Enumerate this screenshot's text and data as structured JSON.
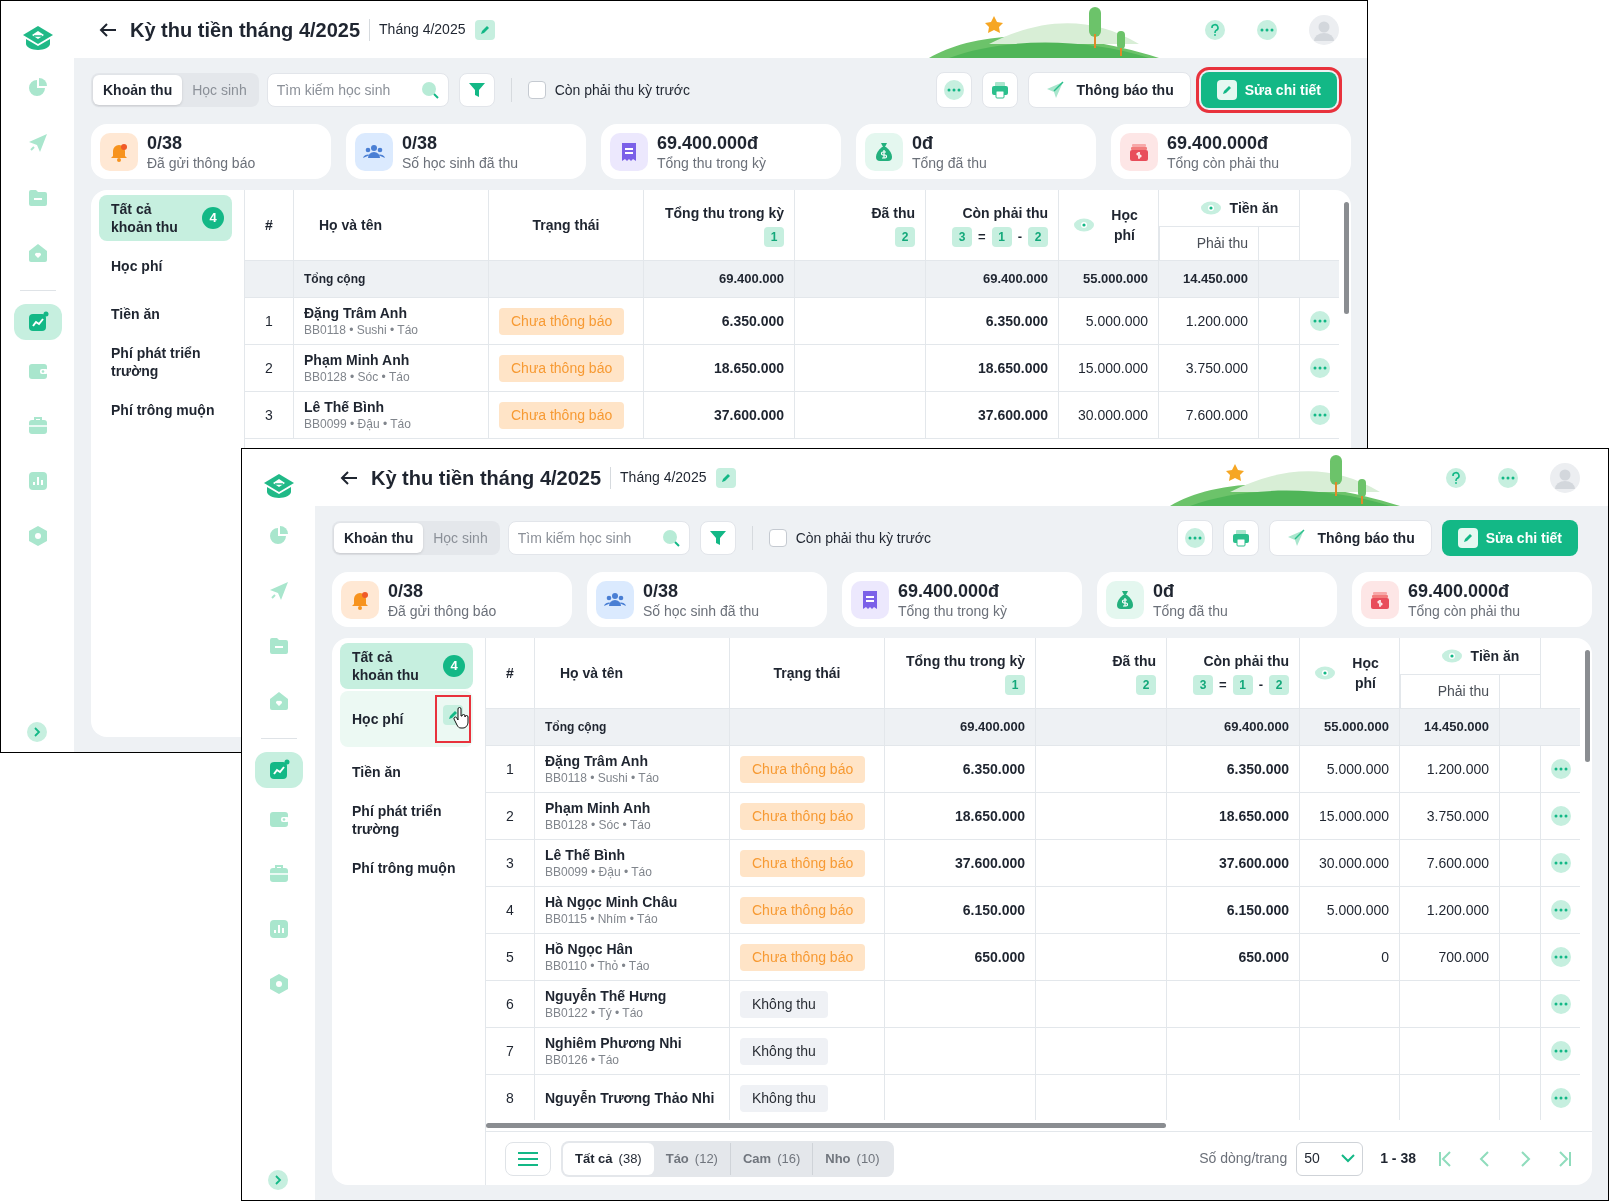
{
  "windows": [
    {
      "sidebar": {
        "items": [
          {
            "kind": "pie",
            "selected": false
          },
          {
            "kind": "send",
            "selected": false
          },
          {
            "kind": "folder",
            "selected": false
          },
          {
            "kind": "home",
            "selected": false
          },
          {
            "kind": "chart",
            "selected": true
          },
          {
            "kind": "wallet",
            "selected": false
          },
          {
            "kind": "briefcase",
            "selected": false
          },
          {
            "kind": "bars",
            "selected": false
          },
          {
            "kind": "hexagon",
            "selected": false
          }
        ]
      },
      "header": {
        "title": "Kỳ thu tiền tháng 4/2025",
        "period": "Tháng 4/2025"
      },
      "toolbar": {
        "tabs": [
          {
            "label": "Khoản thu",
            "selected": true
          },
          {
            "label": "Học sinh",
            "selected": false
          }
        ],
        "search": {
          "placeholder": "Tìm kiếm học sinh"
        },
        "checkbox": {
          "label": "Còn phải thu kỳ trước",
          "checked": false
        },
        "buttons": [
          {
            "kind": "more",
            "highlighted": false
          },
          {
            "kind": "print",
            "highlighted": false
          },
          {
            "kind": "send",
            "label": "Thông báo thu",
            "highlighted": false
          },
          {
            "kind": "edit",
            "label": "Sửa chi tiết",
            "highlighted": true
          }
        ]
      },
      "stats": [
        {
          "kind": "bell",
          "value": "0/38",
          "label": "Đã gửi thông báo"
        },
        {
          "kind": "people",
          "value": "0/38",
          "label": "Số học sinh đã thu"
        },
        {
          "kind": "receipt",
          "value": "69.400.000đ",
          "label": "Tổng thu trong kỳ"
        },
        {
          "kind": "moneybag",
          "value": "0đ",
          "label": "Tổng đã thu"
        },
        {
          "kind": "cash",
          "value": "69.400.000đ",
          "label": "Tổng còn phải thu"
        }
      ],
      "categories": [
        {
          "label": "Tất cả khoản thu",
          "count": "4",
          "selected": true,
          "hovered": false
        },
        {
          "label": "Học phí",
          "selected": false,
          "hovered": false
        },
        {
          "label": "Tiền ăn",
          "selected": false,
          "hovered": false
        },
        {
          "label": "Phí phát triển trường",
          "selected": false,
          "hovered": false
        },
        {
          "label": "Phí trông muộn",
          "selected": false,
          "hovered": false
        }
      ],
      "table": {
        "columns": {
          "index": "#",
          "name": "Họ và tên",
          "status": "Trạng thái",
          "total": {
            "label": "Tổng thu trong kỳ",
            "formula": [
              {
                "kind": "badge",
                "text": "1"
              }
            ]
          },
          "paid": {
            "label": "Đã thu",
            "formula": [
              {
                "kind": "badge",
                "text": "2"
              }
            ]
          },
          "remaining": {
            "label": "Còn phải thu",
            "formula": [
              {
                "kind": "badge",
                "text": "3"
              },
              {
                "kind": "op",
                "text": "="
              },
              {
                "kind": "badge",
                "text": "1"
              },
              {
                "kind": "op",
                "text": "-"
              },
              {
                "kind": "badge",
                "text": "2"
              }
            ]
          },
          "tuition": "Học phí",
          "meals": {
            "label": "Tiền ăn",
            "sub": "Phải thu"
          }
        },
        "total_row": {
          "label": "Tổng cộng",
          "total": "69.400.000",
          "remaining": "69.400.000",
          "tuition": "55.000.000",
          "meals": "14.450.000"
        },
        "rows": [
          {
            "index": "1",
            "name": "Đặng Trâm Anh",
            "meta": "BB0118 • Sushi • Táo",
            "status": "Chưa thông báo",
            "kind": "pending",
            "total": "6.350.000",
            "remaining": "6.350.000",
            "tuition": "5.000.000",
            "meals": "1.200.000"
          },
          {
            "index": "2",
            "name": "Phạm Minh Anh",
            "meta": "BB0128 • Sóc • Táo",
            "status": "Chưa thông báo",
            "kind": "pending",
            "total": "18.650.000",
            "remaining": "18.650.000",
            "tuition": "15.000.000",
            "meals": "3.750.000"
          },
          {
            "index": "3",
            "name": "Lê Thế Bình",
            "meta": "BB0099 • Đậu • Táo",
            "status": "Chưa thông báo",
            "kind": "pending",
            "total": "37.600.000",
            "remaining": "37.600.000",
            "tuition": "30.000.000",
            "meals": "7.600.000"
          }
        ]
      }
    },
    {
      "sidebar": {
        "items": [
          {
            "kind": "pie",
            "selected": false
          },
          {
            "kind": "send",
            "selected": false
          },
          {
            "kind": "folder",
            "selected": false
          },
          {
            "kind": "home",
            "selected": false
          },
          {
            "kind": "chart",
            "selected": true
          },
          {
            "kind": "wallet",
            "selected": false
          },
          {
            "kind": "briefcase",
            "selected": false
          },
          {
            "kind": "bars",
            "selected": false
          },
          {
            "kind": "hexagon",
            "selected": false
          }
        ]
      },
      "header": {
        "title": "Kỳ thu tiền tháng 4/2025",
        "period": "Tháng 4/2025"
      },
      "toolbar": {
        "tabs": [
          {
            "label": "Khoản thu",
            "selected": true
          },
          {
            "label": "Học sinh",
            "selected": false
          }
        ],
        "search": {
          "placeholder": "Tìm kiếm học sinh"
        },
        "checkbox": {
          "label": "Còn phải thu kỳ trước",
          "checked": false
        },
        "buttons": [
          {
            "kind": "more",
            "highlighted": false
          },
          {
            "kind": "print",
            "highlighted": false
          },
          {
            "kind": "send",
            "label": "Thông báo thu",
            "highlighted": false
          },
          {
            "kind": "edit",
            "label": "Sửa chi tiết",
            "highlighted": false
          }
        ]
      },
      "stats": [
        {
          "kind": "bell",
          "value": "0/38",
          "label": "Đã gửi thông báo"
        },
        {
          "kind": "people",
          "value": "0/38",
          "label": "Số học sinh đã thu"
        },
        {
          "kind": "receipt",
          "value": "69.400.000đ",
          "label": "Tổng thu trong kỳ"
        },
        {
          "kind": "moneybag",
          "value": "0đ",
          "label": "Tổng đã thu"
        },
        {
          "kind": "cash",
          "value": "69.400.000đ",
          "label": "Tổng còn phải thu"
        }
      ],
      "categories": [
        {
          "label": "Tất cả khoản thu",
          "count": "4",
          "selected": true,
          "hovered": false
        },
        {
          "label": "Học phí",
          "selected": false,
          "hovered": true,
          "highlighted": true,
          "cursor": true
        },
        {
          "label": "Tiền ăn",
          "selected": false,
          "hovered": false
        },
        {
          "label": "Phí phát triển trường",
          "selected": false,
          "hovered": false
        },
        {
          "label": "Phí trông muộn",
          "selected": false,
          "hovered": false
        }
      ],
      "table": {
        "columns": {
          "index": "#",
          "name": "Họ và tên",
          "status": "Trạng thái",
          "total": {
            "label": "Tổng thu trong kỳ",
            "formula": [
              {
                "kind": "badge",
                "text": "1"
              }
            ]
          },
          "paid": {
            "label": "Đã thu",
            "formula": [
              {
                "kind": "badge",
                "text": "2"
              }
            ]
          },
          "remaining": {
            "label": "Còn phải thu",
            "formula": [
              {
                "kind": "badge",
                "text": "3"
              },
              {
                "kind": "op",
                "text": "="
              },
              {
                "kind": "badge",
                "text": "1"
              },
              {
                "kind": "op",
                "text": "-"
              },
              {
                "kind": "badge",
                "text": "2"
              }
            ]
          },
          "tuition": "Học phí",
          "meals": {
            "label": "Tiền ăn",
            "sub": "Phải thu"
          }
        },
        "total_row": {
          "label": "Tổng cộng",
          "total": "69.400.000",
          "remaining": "69.400.000",
          "tuition": "55.000.000",
          "meals": "14.450.000"
        },
        "rows": [
          {
            "index": "1",
            "name": "Đặng Trâm Anh",
            "meta": "BB0118 • Sushi • Táo",
            "status": "Chưa thông báo",
            "kind": "pending",
            "total": "6.350.000",
            "remaining": "6.350.000",
            "tuition": "5.000.000",
            "meals": "1.200.000"
          },
          {
            "index": "2",
            "name": "Phạm Minh Anh",
            "meta": "BB0128 • Sóc • Táo",
            "status": "Chưa thông báo",
            "kind": "pending",
            "total": "18.650.000",
            "remaining": "18.650.000",
            "tuition": "15.000.000",
            "meals": "3.750.000"
          },
          {
            "index": "3",
            "name": "Lê Thế Bình",
            "meta": "BB0099 • Đậu • Táo",
            "status": "Chưa thông báo",
            "kind": "pending",
            "total": "37.600.000",
            "remaining": "37.600.000",
            "tuition": "30.000.000",
            "meals": "7.600.000"
          },
          {
            "index": "4",
            "name": "Hà Ngọc Minh Châu",
            "meta": "BB0115 • Nhím • Táo",
            "status": "Chưa thông báo",
            "kind": "pending",
            "total": "6.150.000",
            "remaining": "6.150.000",
            "tuition": "5.000.000",
            "meals": "1.200.000"
          },
          {
            "index": "5",
            "name": "Hồ Ngọc Hân",
            "meta": "BB0110 • Thỏ • Táo",
            "status": "Chưa thông báo",
            "kind": "pending",
            "total": "650.000",
            "remaining": "650.000",
            "tuition": "0",
            "meals": "700.000"
          },
          {
            "index": "6",
            "name": "Nguyễn Thế Hưng",
            "meta": "BB0122 • Tý • Táo",
            "status": "Không thu",
            "kind": "exempt"
          },
          {
            "index": "7",
            "name": "Nghiêm Phương Nhi",
            "meta": "BB0126 • Táo",
            "status": "Không thu",
            "kind": "exempt"
          },
          {
            "index": "8",
            "name": "Nguyễn Trương Thảo Nhi",
            "status": "Không thu",
            "kind": "exempt"
          }
        ]
      },
      "footer": {
        "tabs": [
          {
            "label": "Tất cả",
            "count": "(38)",
            "selected": true
          },
          {
            "label": "Táo",
            "count": "(12)",
            "selected": false
          },
          {
            "label": "Cam",
            "count": "(16)",
            "selected": false
          },
          {
            "label": "Nho",
            "count": "(10)",
            "selected": false
          }
        ],
        "page_size_label": "Số dòng/trang",
        "page_size": "50",
        "range": "1 - 38"
      }
    }
  ]
}
